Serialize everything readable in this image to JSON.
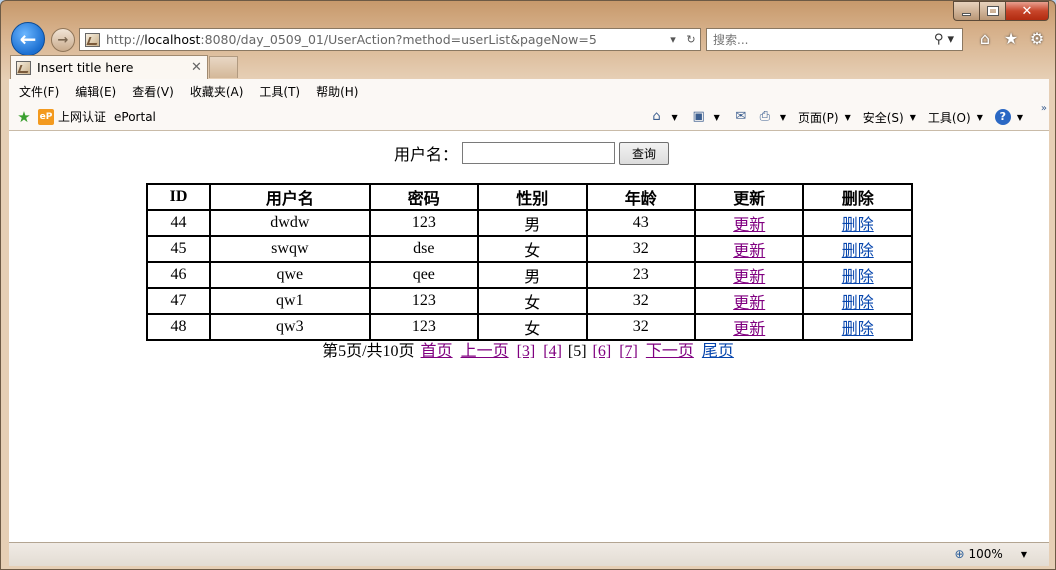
{
  "browser": {
    "url_prefix": "http://",
    "url_host": "localhost",
    "url_rest": ":8080/day_0509_01/UserAction?method=userList&pageNow=5",
    "search_placeholder": "搜索...",
    "tab_title": "Insert title here",
    "menu": [
      "文件(F)",
      "编辑(E)",
      "查看(V)",
      "收藏夹(A)",
      "工具(T)",
      "帮助(H)"
    ],
    "favorites": [
      "上网认证",
      "ePortal"
    ],
    "ep_badge": "eP",
    "commands": {
      "page": "页面(P)",
      "safety": "安全(S)",
      "tools": "工具(O)"
    },
    "zoom": "100%"
  },
  "page": {
    "search_label": "用户名：",
    "search_value": "",
    "search_button": "查询",
    "table": {
      "headers": [
        "ID",
        "用户名",
        "密码",
        "性别",
        "年龄",
        "更新",
        "删除"
      ],
      "rows": [
        {
          "id": "44",
          "username": "dwdw",
          "password": "123",
          "gender": "男",
          "age": "43",
          "update": "更新",
          "delete": "删除"
        },
        {
          "id": "45",
          "username": "swqw",
          "password": "dse",
          "gender": "女",
          "age": "32",
          "update": "更新",
          "delete": "删除"
        },
        {
          "id": "46",
          "username": "qwe",
          "password": "qee",
          "gender": "男",
          "age": "23",
          "update": "更新",
          "delete": "删除"
        },
        {
          "id": "47",
          "username": "qw1",
          "password": "123",
          "gender": "女",
          "age": "32",
          "update": "更新",
          "delete": "删除"
        },
        {
          "id": "48",
          "username": "qw3",
          "password": "123",
          "gender": "女",
          "age": "32",
          "update": "更新",
          "delete": "删除"
        }
      ]
    },
    "pager": {
      "status": "第5页/共10页",
      "first": "首页",
      "prev": "上一页",
      "p3": "[3]",
      "p4": "[4]",
      "current": "[5]",
      "p6": "[6]",
      "p7": "[7]",
      "next": "下一页",
      "last": "尾页"
    }
  },
  "colors": {
    "visited_link": "#800080",
    "unvisited_link": "#0645ad",
    "back_button": "#1b6fd1"
  }
}
